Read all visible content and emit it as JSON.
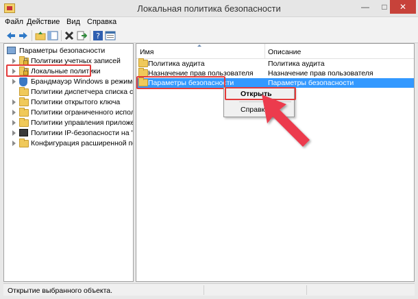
{
  "window": {
    "title": "Локальная политика безопасности"
  },
  "window_controls": {
    "minimize": "—",
    "maximize": "□",
    "close": "✕"
  },
  "menu": [
    "Файл",
    "Действие",
    "Вид",
    "Справка"
  ],
  "toolbar": {
    "buttons": [
      "back-icon",
      "forward-icon",
      "up-folder-icon",
      "show-hide-tree-icon",
      "delete-icon",
      "export-icon",
      "help-icon",
      "properties-icon"
    ]
  },
  "tree": {
    "root": "Параметры безопасности",
    "items": [
      "Политики учетных записей",
      "Локальные политики",
      "Брандмауэр Windows в режиме пов",
      "Политики диспетчера списка сетей",
      "Политики открытого ключа",
      "Политики ограниченного использо",
      "Политики управления приложения",
      "Политики IP-безопасности на \"Лока",
      "Конфигурация расширенной полит"
    ]
  },
  "list": {
    "columns": [
      "Имя",
      "Описание"
    ],
    "rows": [
      {
        "name": "Политика аудита",
        "desc": "Политика аудита"
      },
      {
        "name": "Назначение прав пользователя",
        "desc": "Назначение прав пользователя"
      },
      {
        "name": "Параметры безопасности",
        "desc": "Параметры безопасности"
      }
    ]
  },
  "context_menu": {
    "items": [
      "Открыть",
      "Справка"
    ]
  },
  "status": {
    "text": "Открытие выбранного объекта."
  },
  "colors": {
    "selection": "#3399ff",
    "highlight": "#e33a3a",
    "arrow": "#ec3b4d"
  }
}
